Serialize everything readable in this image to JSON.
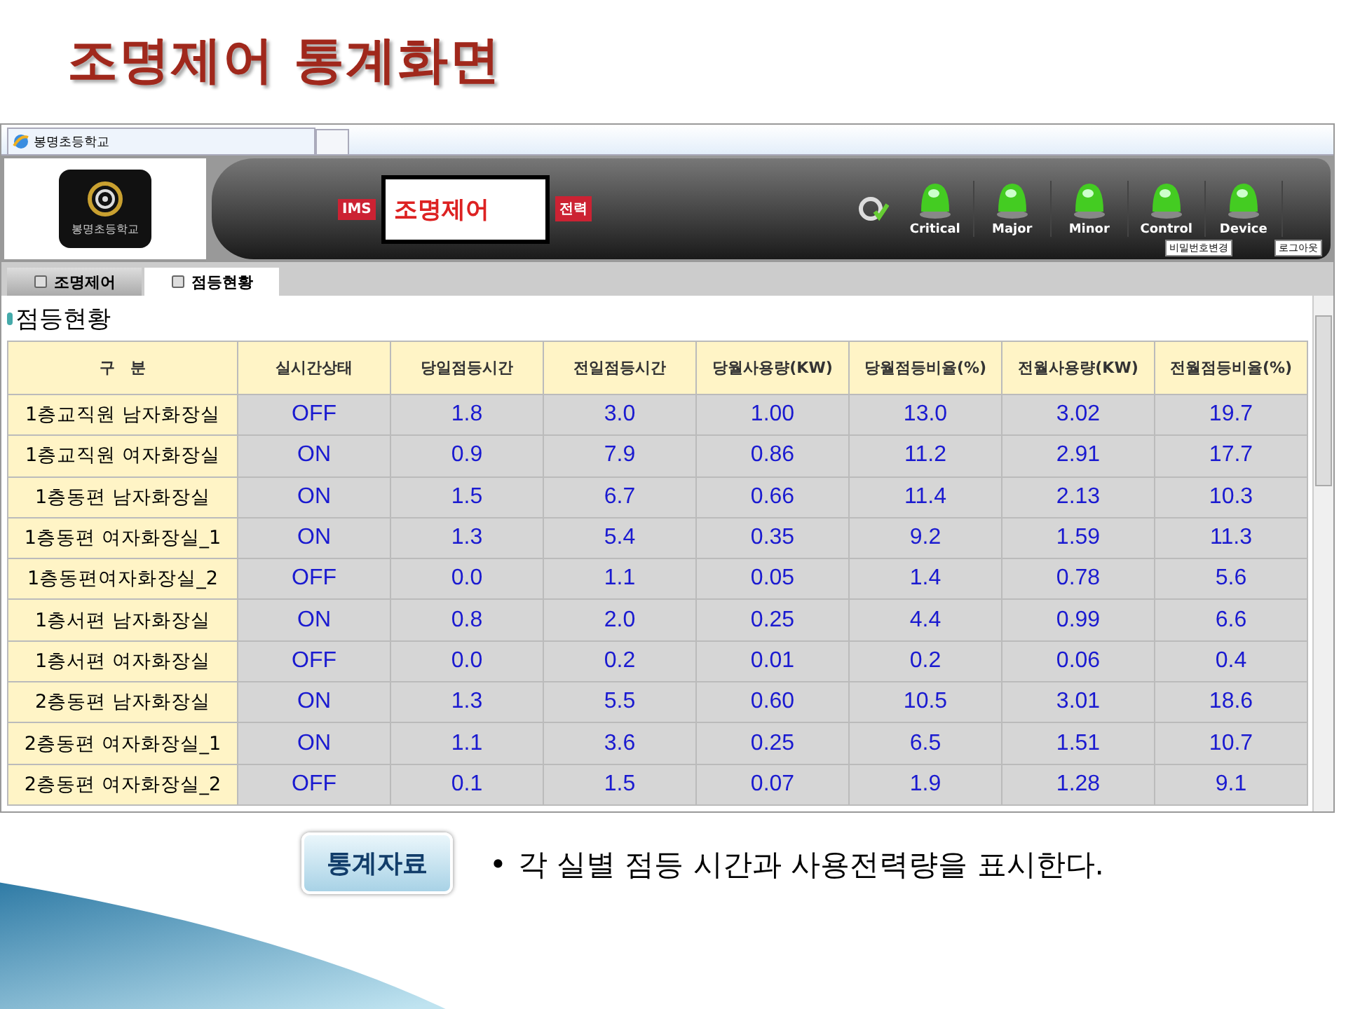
{
  "slide_title": "조명제어 통계화면",
  "browser": {
    "tab_title": "봉명초등학교"
  },
  "header": {
    "logo_text": "봉명초등학교",
    "menu": [
      {
        "label": "IMS",
        "selected": false
      },
      {
        "label": "조명제어",
        "selected": true
      },
      {
        "label": "전력",
        "selected": false
      }
    ],
    "alarms": [
      "Critical",
      "Major",
      "Minor",
      "Control",
      "Device"
    ],
    "buttons": [
      "비밀번호변경",
      "로그아웃"
    ]
  },
  "tabs": [
    {
      "label": "조명제어",
      "selected": false
    },
    {
      "label": "점등현황",
      "selected": true
    }
  ],
  "section_title": "점등현황",
  "table": {
    "columns": [
      "구　분",
      "실시간상태",
      "당일점등시간",
      "전일점등시간",
      "당월사용량(KW)",
      "당월점등비율(%)",
      "전월사용량(KW)",
      "전월점등비율(%)"
    ],
    "rows": [
      [
        "1층교직원 남자화장실",
        "OFF",
        "1.8",
        "3.0",
        "1.00",
        "13.0",
        "3.02",
        "19.7"
      ],
      [
        "1층교직원 여자화장실",
        "ON",
        "0.9",
        "7.9",
        "0.86",
        "11.2",
        "2.91",
        "17.7"
      ],
      [
        "1층동편 남자화장실",
        "ON",
        "1.5",
        "6.7",
        "0.66",
        "11.4",
        "2.13",
        "10.3"
      ],
      [
        "1층동편 여자화장실_1",
        "ON",
        "1.3",
        "5.4",
        "0.35",
        "9.2",
        "1.59",
        "11.3"
      ],
      [
        "1층동편여자화장실_2",
        "OFF",
        "0.0",
        "1.1",
        "0.05",
        "1.4",
        "0.78",
        "5.6"
      ],
      [
        "1층서편 남자화장실",
        "ON",
        "0.8",
        "2.0",
        "0.25",
        "4.4",
        "0.99",
        "6.6"
      ],
      [
        "1층서편 여자화장실",
        "OFF",
        "0.0",
        "0.2",
        "0.01",
        "0.2",
        "0.06",
        "0.4"
      ],
      [
        "2층동편 남자화장실",
        "ON",
        "1.3",
        "5.5",
        "0.60",
        "10.5",
        "3.01",
        "18.6"
      ],
      [
        "2층동편 여자화장실_1",
        "ON",
        "1.1",
        "3.6",
        "0.25",
        "6.5",
        "1.51",
        "10.7"
      ],
      [
        "2층동편 여자화장실_2",
        "OFF",
        "0.1",
        "1.5",
        "0.07",
        "1.9",
        "1.28",
        "9.1"
      ]
    ]
  },
  "caption": {
    "button": "통계자료",
    "bullet": "•",
    "text": "각 실별 점등 시간과 사용전력량을 표시한다."
  }
}
